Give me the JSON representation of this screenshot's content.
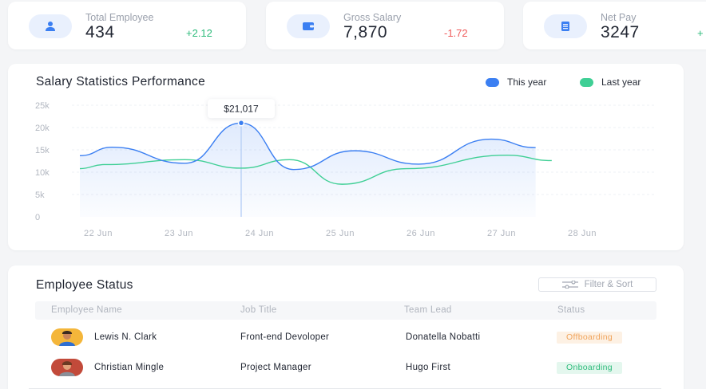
{
  "stats": [
    {
      "label": "Total Employee",
      "value": "434",
      "delta": "+2.12",
      "icon": "user-icon"
    },
    {
      "label": "Gross Salary",
      "value": "7,870",
      "delta": "-1.72",
      "icon": "wallet-icon"
    },
    {
      "label": "Net Pay",
      "value": "3247",
      "delta": "+",
      "icon": "document-icon"
    }
  ],
  "colors": {
    "this_year": "#3b7ff2",
    "last_year": "#3fcf95",
    "positive": "#2dbb7b",
    "negative": "#ef5a5a"
  },
  "chart": {
    "title": "Salary Statistics Performance",
    "legend": {
      "this_year": "This year",
      "last_year": "Last year"
    },
    "tooltip": "$21,017"
  },
  "chart_data": {
    "type": "area",
    "x": [
      "22 Jun",
      "23 Jun",
      "24 Jun",
      "25 Jun",
      "26 Jun",
      "27 Jun",
      "28 Jun"
    ],
    "y_ticks": [
      "25k",
      "20k",
      "15k",
      "10k",
      "5k",
      "0"
    ],
    "ylim": [
      0,
      25000
    ],
    "grid": true,
    "legend_position": "top-right",
    "series": [
      {
        "name": "This year",
        "color": "#3b7ff2",
        "points": [
          [
            0.0,
            13700
          ],
          [
            0.4,
            15600
          ],
          [
            1.3,
            12000
          ],
          [
            2.0,
            21017
          ],
          [
            2.65,
            10600
          ],
          [
            3.4,
            14800
          ],
          [
            4.2,
            11800
          ],
          [
            5.1,
            17400
          ],
          [
            5.65,
            15500
          ]
        ]
      },
      {
        "name": "Last year",
        "color": "#3fcf95",
        "points": [
          [
            0.0,
            10800
          ],
          [
            0.3,
            11700
          ],
          [
            1.3,
            12800
          ],
          [
            2.0,
            10900
          ],
          [
            2.6,
            12800
          ],
          [
            3.25,
            7300
          ],
          [
            4.05,
            10800
          ],
          [
            5.3,
            13800
          ],
          [
            5.85,
            12600
          ]
        ]
      }
    ],
    "highlight": {
      "x": 2.0,
      "y": 21017,
      "label": "$21,017"
    }
  },
  "status": {
    "title": "Employee Status",
    "filter_label": "Filter & Sort",
    "columns": [
      "Employee Name",
      "Job Title",
      "Team Lead",
      "Status"
    ],
    "rows": [
      {
        "name": "Lewis N. Clark",
        "job": "Front-end Devoloper",
        "lead": "Donatella Nobatti",
        "status": "Offboarding",
        "status_kind": "off"
      },
      {
        "name": "Christian Mingle",
        "job": "Project Manager",
        "lead": "Hugo First",
        "status": "Onboarding",
        "status_kind": "on"
      }
    ]
  }
}
